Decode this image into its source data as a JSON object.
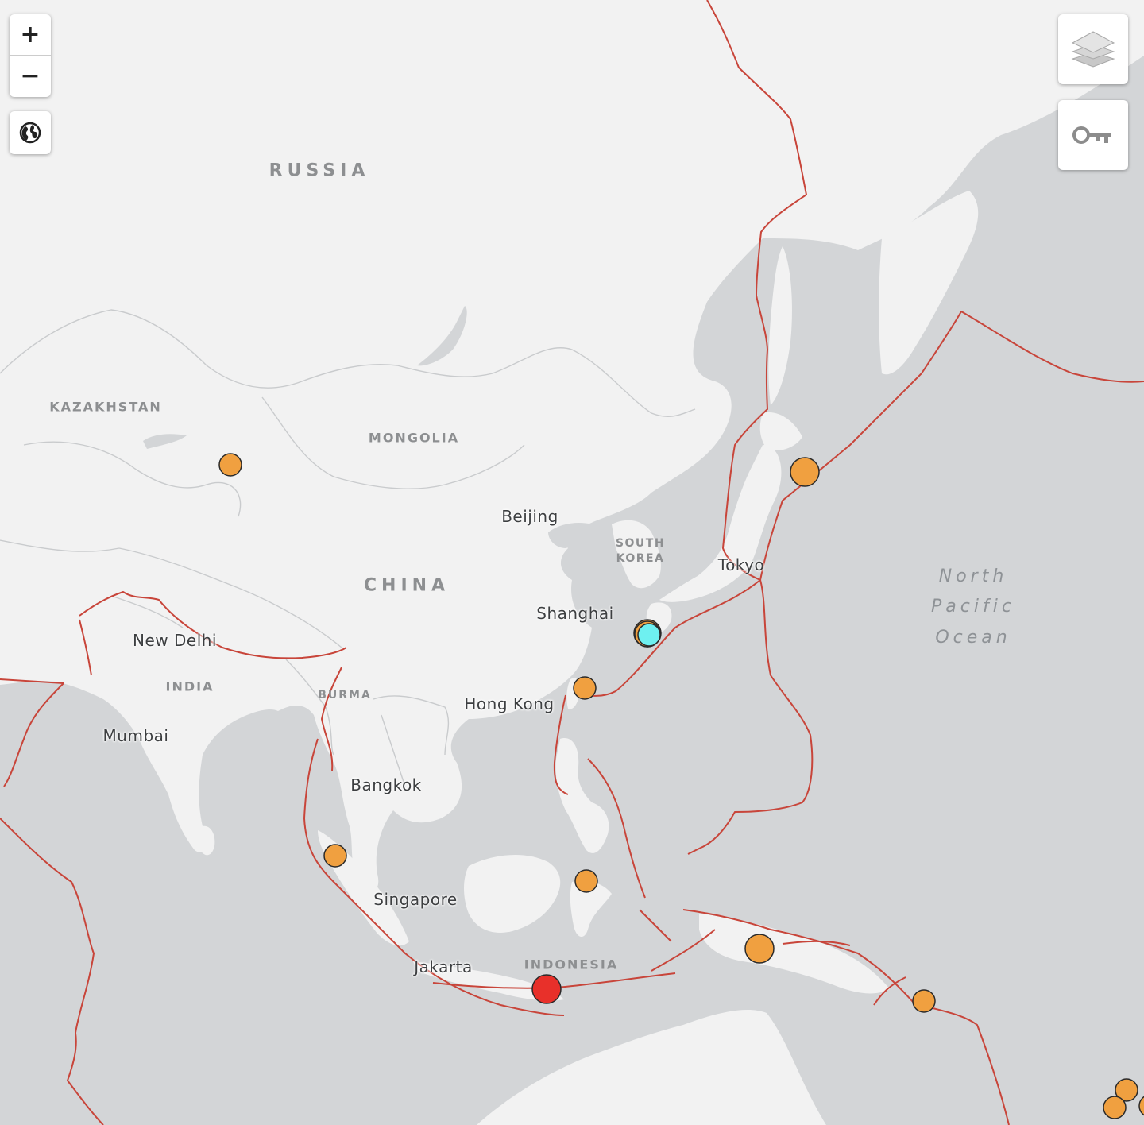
{
  "controls": {
    "zoom_in": "+",
    "zoom_out": "−"
  },
  "labels": {
    "russia": "RUSSIA",
    "kazakhstan": "KAZAKHSTAN",
    "mongolia": "MONGOLIA",
    "china": "CHINA",
    "south_korea_1": "SOUTH",
    "south_korea_2": "KOREA",
    "india": "INDIA",
    "burma": "BURMA",
    "indonesia": "INDONESIA",
    "beijing": "Beijing",
    "shanghai": "Shanghai",
    "tokyo": "Tokyo",
    "hong_kong": "Hong Kong",
    "new_delhi": "New Delhi",
    "mumbai": "Mumbai",
    "bangkok": "Bangkok",
    "singapore": "Singapore",
    "jakarta": "Jakarta",
    "ocean_1": "North",
    "ocean_2": "Pacific",
    "ocean_3": "Ocean"
  },
  "colors": {
    "land": "#f2f2f2",
    "water": "#d3d5d7",
    "plate_boundary": "#c8453a",
    "quake_orange": "#f0a040",
    "quake_red": "#e8302a",
    "quake_cyan": "#6ef0f0"
  },
  "icons": {
    "layers": "layers-icon",
    "legend": "key-icon",
    "world": "globe-icon"
  }
}
